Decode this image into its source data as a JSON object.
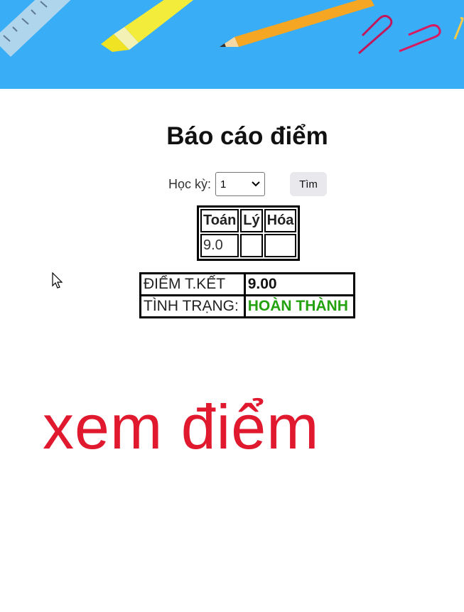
{
  "page": {
    "title": "Báo cáo điểm"
  },
  "filter": {
    "semester_label": "Học kỳ:",
    "semester_value": "1",
    "find_button": "Tìm"
  },
  "scores": {
    "headers": [
      "Toán",
      "Lý",
      "Hóa"
    ],
    "row": [
      "9.0",
      "",
      ""
    ]
  },
  "summary": {
    "final_label": "ĐIỂM T.KẾT",
    "final_value": "9.00",
    "status_label": "TÌNH TRẠNG:",
    "status_value": "HOÀN THÀNH",
    "status_color": "#23a10f"
  },
  "overlay": {
    "caption": "xem điểm",
    "caption_color": "#e0192e"
  },
  "banner": {
    "background_color": "#39adf5",
    "items": [
      "ruler-icon",
      "highlighter-icon",
      "pencil-icon",
      "paperclip-icon"
    ]
  }
}
